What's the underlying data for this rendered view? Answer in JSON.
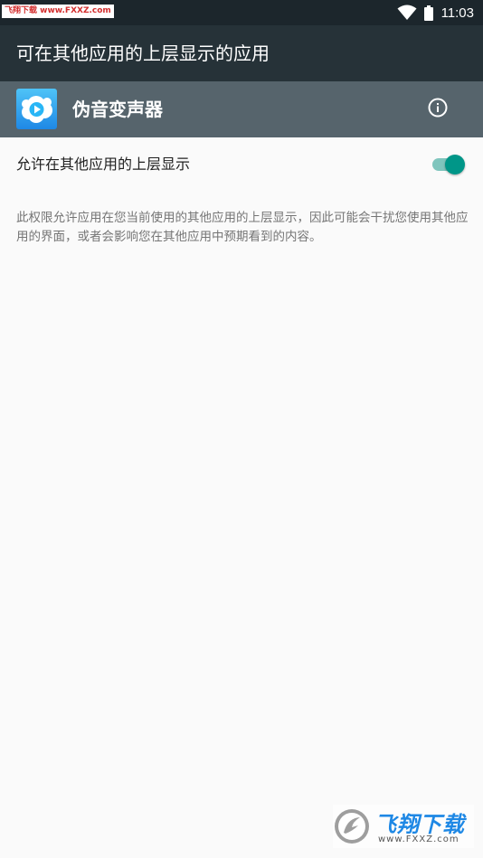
{
  "status_bar": {
    "watermark": "飞翔下载 www.FXXZ.com",
    "time": "11:03",
    "icons": [
      "wifi-icon",
      "battery-icon"
    ]
  },
  "toolbar": {
    "title": "可在其他应用的上层显示的应用"
  },
  "app": {
    "name": "伪音变声器",
    "icon": "app-cloud-play-icon",
    "info_icon": "info-icon"
  },
  "setting": {
    "label": "允许在其他应用的上层显示",
    "enabled": true,
    "description": "此权限允许应用在您当前使用的其他应用的上层显示，因此可能会干扰您使用其他应用的界面，或者会影响您在其他应用中预期看到的内容。"
  },
  "watermark_bottom": {
    "text": "飞翔下载",
    "url": "www.FXXZ.com"
  },
  "colors": {
    "status_bar": "#1c262c",
    "toolbar": "#263238",
    "app_row": "#56646c",
    "accent": "#009688",
    "background": "#fafafa"
  }
}
